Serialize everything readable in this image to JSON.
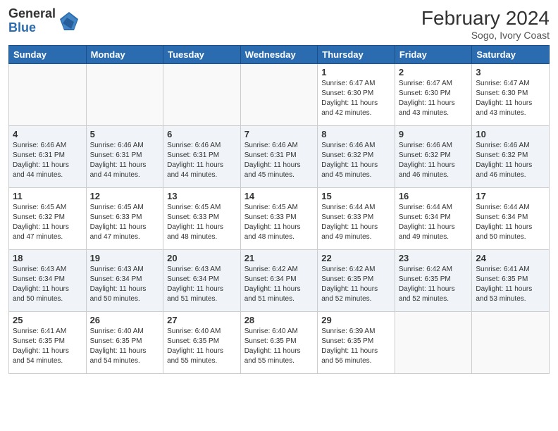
{
  "logo": {
    "general": "General",
    "blue": "Blue"
  },
  "title": "February 2024",
  "subtitle": "Sogo, Ivory Coast",
  "days_of_week": [
    "Sunday",
    "Monday",
    "Tuesday",
    "Wednesday",
    "Thursday",
    "Friday",
    "Saturday"
  ],
  "weeks": [
    [
      {
        "day": "",
        "info": ""
      },
      {
        "day": "",
        "info": ""
      },
      {
        "day": "",
        "info": ""
      },
      {
        "day": "",
        "info": ""
      },
      {
        "day": "1",
        "info": "Sunrise: 6:47 AM\nSunset: 6:30 PM\nDaylight: 11 hours and 42 minutes."
      },
      {
        "day": "2",
        "info": "Sunrise: 6:47 AM\nSunset: 6:30 PM\nDaylight: 11 hours and 43 minutes."
      },
      {
        "day": "3",
        "info": "Sunrise: 6:47 AM\nSunset: 6:30 PM\nDaylight: 11 hours and 43 minutes."
      }
    ],
    [
      {
        "day": "4",
        "info": "Sunrise: 6:46 AM\nSunset: 6:31 PM\nDaylight: 11 hours and 44 minutes."
      },
      {
        "day": "5",
        "info": "Sunrise: 6:46 AM\nSunset: 6:31 PM\nDaylight: 11 hours and 44 minutes."
      },
      {
        "day": "6",
        "info": "Sunrise: 6:46 AM\nSunset: 6:31 PM\nDaylight: 11 hours and 44 minutes."
      },
      {
        "day": "7",
        "info": "Sunrise: 6:46 AM\nSunset: 6:31 PM\nDaylight: 11 hours and 45 minutes."
      },
      {
        "day": "8",
        "info": "Sunrise: 6:46 AM\nSunset: 6:32 PM\nDaylight: 11 hours and 45 minutes."
      },
      {
        "day": "9",
        "info": "Sunrise: 6:46 AM\nSunset: 6:32 PM\nDaylight: 11 hours and 46 minutes."
      },
      {
        "day": "10",
        "info": "Sunrise: 6:46 AM\nSunset: 6:32 PM\nDaylight: 11 hours and 46 minutes."
      }
    ],
    [
      {
        "day": "11",
        "info": "Sunrise: 6:45 AM\nSunset: 6:32 PM\nDaylight: 11 hours and 47 minutes."
      },
      {
        "day": "12",
        "info": "Sunrise: 6:45 AM\nSunset: 6:33 PM\nDaylight: 11 hours and 47 minutes."
      },
      {
        "day": "13",
        "info": "Sunrise: 6:45 AM\nSunset: 6:33 PM\nDaylight: 11 hours and 48 minutes."
      },
      {
        "day": "14",
        "info": "Sunrise: 6:45 AM\nSunset: 6:33 PM\nDaylight: 11 hours and 48 minutes."
      },
      {
        "day": "15",
        "info": "Sunrise: 6:44 AM\nSunset: 6:33 PM\nDaylight: 11 hours and 49 minutes."
      },
      {
        "day": "16",
        "info": "Sunrise: 6:44 AM\nSunset: 6:34 PM\nDaylight: 11 hours and 49 minutes."
      },
      {
        "day": "17",
        "info": "Sunrise: 6:44 AM\nSunset: 6:34 PM\nDaylight: 11 hours and 50 minutes."
      }
    ],
    [
      {
        "day": "18",
        "info": "Sunrise: 6:43 AM\nSunset: 6:34 PM\nDaylight: 11 hours and 50 minutes."
      },
      {
        "day": "19",
        "info": "Sunrise: 6:43 AM\nSunset: 6:34 PM\nDaylight: 11 hours and 50 minutes."
      },
      {
        "day": "20",
        "info": "Sunrise: 6:43 AM\nSunset: 6:34 PM\nDaylight: 11 hours and 51 minutes."
      },
      {
        "day": "21",
        "info": "Sunrise: 6:42 AM\nSunset: 6:34 PM\nDaylight: 11 hours and 51 minutes."
      },
      {
        "day": "22",
        "info": "Sunrise: 6:42 AM\nSunset: 6:35 PM\nDaylight: 11 hours and 52 minutes."
      },
      {
        "day": "23",
        "info": "Sunrise: 6:42 AM\nSunset: 6:35 PM\nDaylight: 11 hours and 52 minutes."
      },
      {
        "day": "24",
        "info": "Sunrise: 6:41 AM\nSunset: 6:35 PM\nDaylight: 11 hours and 53 minutes."
      }
    ],
    [
      {
        "day": "25",
        "info": "Sunrise: 6:41 AM\nSunset: 6:35 PM\nDaylight: 11 hours and 54 minutes."
      },
      {
        "day": "26",
        "info": "Sunrise: 6:40 AM\nSunset: 6:35 PM\nDaylight: 11 hours and 54 minutes."
      },
      {
        "day": "27",
        "info": "Sunrise: 6:40 AM\nSunset: 6:35 PM\nDaylight: 11 hours and 55 minutes."
      },
      {
        "day": "28",
        "info": "Sunrise: 6:40 AM\nSunset: 6:35 PM\nDaylight: 11 hours and 55 minutes."
      },
      {
        "day": "29",
        "info": "Sunrise: 6:39 AM\nSunset: 6:35 PM\nDaylight: 11 hours and 56 minutes."
      },
      {
        "day": "",
        "info": ""
      },
      {
        "day": "",
        "info": ""
      }
    ]
  ]
}
